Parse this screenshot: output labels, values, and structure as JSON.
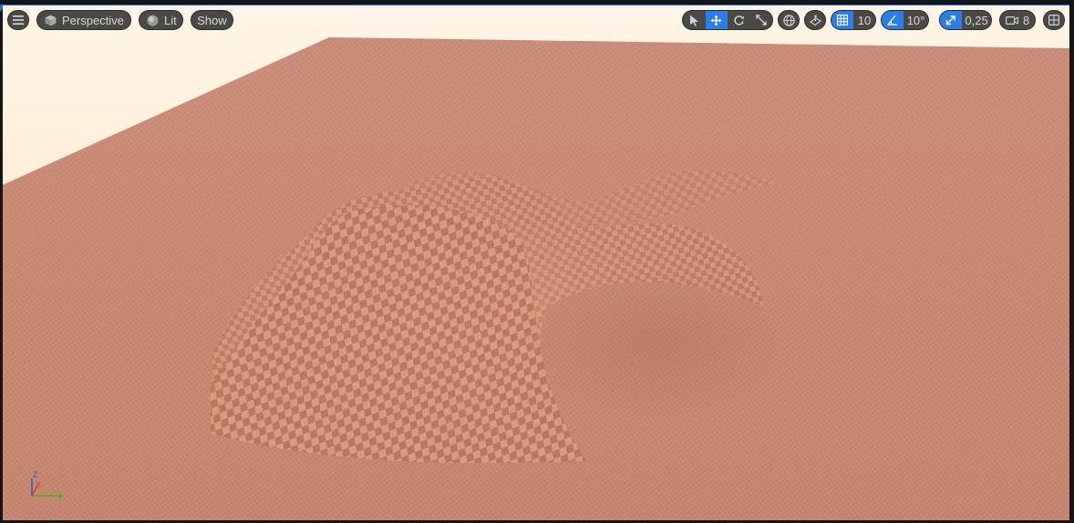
{
  "toolbar_left": {
    "menu_icon": "hamburger-menu-icon",
    "view_mode": {
      "label": "Perspective",
      "icon": "cube-icon"
    },
    "lighting": {
      "label": "Lit",
      "icon": "lit-sphere-icon"
    },
    "show": {
      "label": "Show"
    }
  },
  "toolbar_right": {
    "transform_tools": [
      "select-arrow-icon",
      "translate-icon",
      "rotate-icon",
      "scale-icon"
    ],
    "active_transform": "translate",
    "world_local_icon": "globe-icon",
    "surface_snap_icon": "surface-snap-icon",
    "grid_snap": {
      "icon": "grid-icon",
      "value": "10",
      "enabled": true
    },
    "rotation_snap": {
      "icon": "angle-icon",
      "value": "10°",
      "enabled": true
    },
    "scale_snap": {
      "icon": "scale-arrow-icon",
      "value": "0,25",
      "enabled": true
    },
    "camera_speed": {
      "icon": "camera-icon",
      "value": "8"
    },
    "layout_icon": "viewport-layout-icon"
  },
  "axis_gizmo": {
    "labels": [
      "Z",
      "X",
      "Y"
    ]
  },
  "colors": {
    "accent": "#2b7de8",
    "sky": "#fdf1de",
    "ground": "#c98a75",
    "checker_dark": "#b7705b",
    "checker_light": "#d89a82"
  }
}
